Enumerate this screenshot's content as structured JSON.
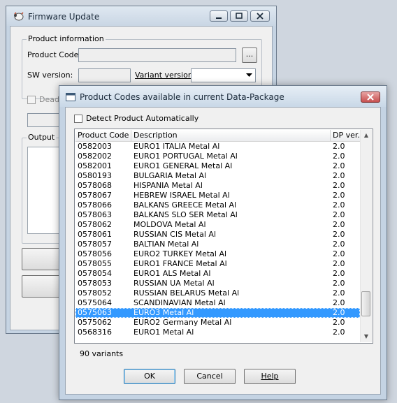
{
  "bg_window": {
    "title": "Firmware Update",
    "product_info": {
      "group_title": "Product information",
      "product_code_label": "Product Code:",
      "product_code_value": "",
      "browse_label": "...",
      "sw_version_label": "SW version:",
      "sw_version_value": "",
      "variant_label": "Variant version:",
      "variant_value": ""
    },
    "dead_checkbox_label": "Dead",
    "output_group_title": "Output"
  },
  "dialog": {
    "title": "Product Codes available in current Data-Package",
    "detect_checkbox_label": "Detect Product Automatically",
    "detect_checked": false,
    "columns": [
      "Product Code",
      "Description",
      "DP ver."
    ],
    "rows": [
      {
        "code": "0582003",
        "desc": "EURO1 ITALIA Metal Al",
        "ver": "2.0"
      },
      {
        "code": "0582002",
        "desc": "EURO1 PORTUGAL Metal Al",
        "ver": "2.0"
      },
      {
        "code": "0582001",
        "desc": "EURO1 GENERAL Metal Al",
        "ver": "2.0"
      },
      {
        "code": "0580193",
        "desc": "BULGARIA Metal Al",
        "ver": "2.0"
      },
      {
        "code": "0578068",
        "desc": "HISPANIA Metal Al",
        "ver": "2.0"
      },
      {
        "code": "0578067",
        "desc": "HEBREW ISRAEL Metal Al",
        "ver": "2.0"
      },
      {
        "code": "0578066",
        "desc": "BALKANS GREECE Metal Al",
        "ver": "2.0"
      },
      {
        "code": "0578063",
        "desc": "BALKANS SLO SER Metal Al",
        "ver": "2.0"
      },
      {
        "code": "0578062",
        "desc": "MOLDOVA Metal Al",
        "ver": "2.0"
      },
      {
        "code": "0578061",
        "desc": "RUSSIAN CIS Metal Al",
        "ver": "2.0"
      },
      {
        "code": "0578057",
        "desc": "BALTIAN Metal Al",
        "ver": "2.0"
      },
      {
        "code": "0578056",
        "desc": "EURO2 TURKEY Metal Al",
        "ver": "2.0"
      },
      {
        "code": "0578055",
        "desc": "EURO1 FRANCE Metal Al",
        "ver": "2.0"
      },
      {
        "code": "0578054",
        "desc": "EURO1 ALS Metal Al",
        "ver": "2.0"
      },
      {
        "code": "0578053",
        "desc": "RUSSIAN UA Metal Al",
        "ver": "2.0"
      },
      {
        "code": "0578052",
        "desc": "RUSSIAN BELARUS Metal Al",
        "ver": "2.0"
      },
      {
        "code": "0575064",
        "desc": "SCANDINAVIAN Metal Al",
        "ver": "2.0"
      },
      {
        "code": "0575063",
        "desc": "EURO3 Metal Al",
        "ver": "2.0"
      },
      {
        "code": "0575062",
        "desc": "EURO2 Germany Metal Al",
        "ver": "2.0"
      },
      {
        "code": "0568316",
        "desc": "EURO1 Metal Al",
        "ver": "2.0"
      }
    ],
    "selected_index": 17,
    "variant_count": "90 variants",
    "ok_label": "OK",
    "cancel_label": "Cancel",
    "help_label": "Help"
  },
  "colors": {
    "selection": "#3399ff",
    "window_face": "#f0f0f0",
    "dialog_frame": "#c4d3e3",
    "close_button": "#c75050"
  },
  "icons": {
    "app_icon": "sheep-icon",
    "dialog_icon": "window-icon",
    "minimize": "minimize-icon",
    "maximize": "maximize-icon",
    "close": "close-icon",
    "dropdown": "chevron-down-icon"
  }
}
